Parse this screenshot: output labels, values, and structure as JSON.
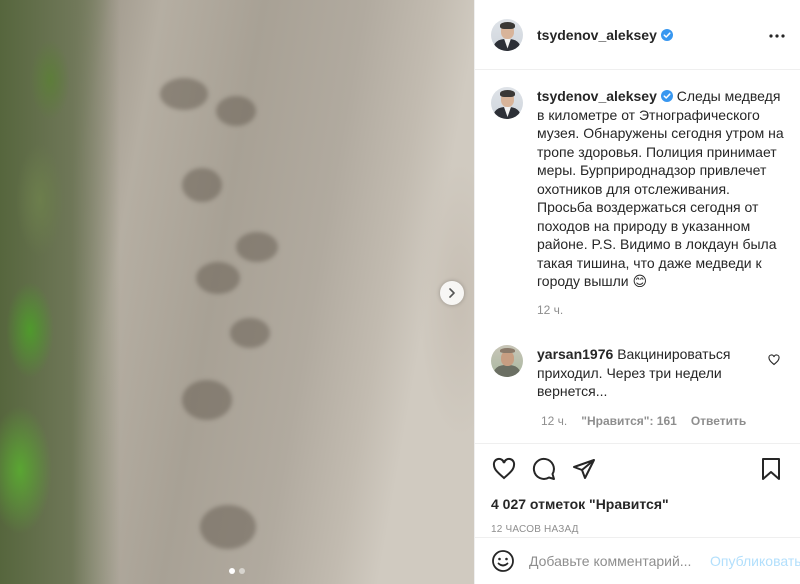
{
  "post": {
    "author": "tsydenov_aleksey",
    "verified": true,
    "caption": "Следы медведя в километре от Этнографического музея. Обнаружены сегодня утром на тропе здоровья. Полиция принимает меры. Бурприроднадзор привлечет охотников для отслеживания. Просьба воздержаться сегодня от походов на природу в указанном районе. P.S. Видимо в локдаун была такая тишина, что даже медведи к городу вышли 😊",
    "caption_age": "12 ч.",
    "likes_text": "4 027 отметок \"Нравится\"",
    "timestamp": "12 ЧАСОВ НАЗАД"
  },
  "comments": [
    {
      "author": "yarsan1976",
      "text": "Вакцинироваться приходил. Через три недели вернется...",
      "age": "12 ч.",
      "likes_label": "\"Нравится\": 161",
      "reply_label": "Ответить"
    }
  ],
  "add_comment": {
    "placeholder": "Добавьте комментарий...",
    "publish_label": "Опубликовать"
  },
  "carousel": {
    "total": 2,
    "current": 1
  },
  "icons": {
    "verified": "verified-badge-icon",
    "more": "more-options-icon",
    "like": "heart-icon",
    "comment": "comment-icon",
    "share": "share-icon",
    "save": "bookmark-icon",
    "emoji": "emoji-icon",
    "next": "chevron-right-icon"
  },
  "colors": {
    "verified": "#3897f0",
    "publish": "#b2dffc",
    "muted": "#8e8e8e"
  }
}
